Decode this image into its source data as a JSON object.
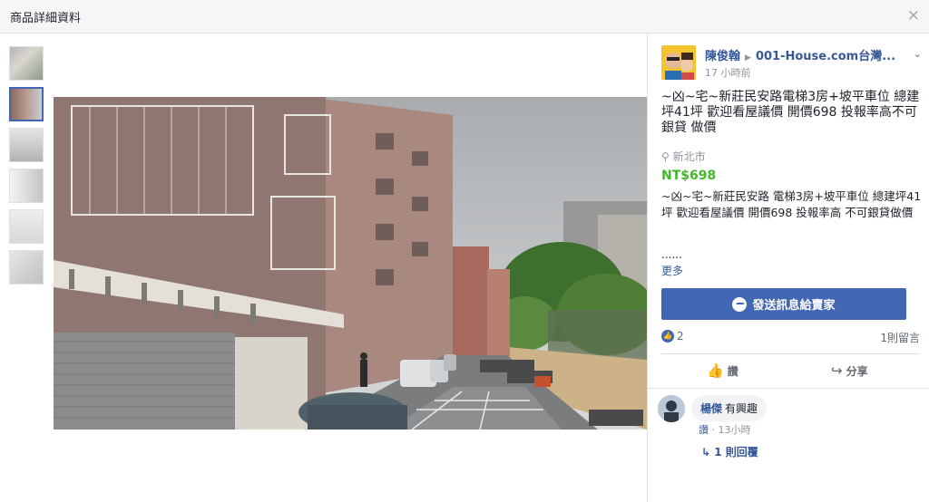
{
  "window": {
    "title": "商品詳細資料",
    "close_glyph": "×"
  },
  "gallery": {
    "thumb_count": 6,
    "active_index": 1
  },
  "seller": {
    "name": "陳俊翰",
    "arrow": "▶",
    "group": "001-House.com台灣...",
    "time": "17 小時前",
    "menu_glyph": "⌄"
  },
  "listing": {
    "title": "~凶~宅~新莊民安路電梯3房+坡平車位 總建坪41坪 歡迎看屋議價 開價698 投報率高不可銀貸 做價",
    "location_icon": "⚲",
    "location": "新北市",
    "price": "NT$698",
    "description": "~凶~宅~新莊民安路 電梯3房+坡平車位 總建坪41坪 歡迎看屋議價 開價698 投報率高 不可銀貸做價",
    "ellipsis": "......",
    "more": "更多"
  },
  "message_button": {
    "label": "發送訊息給賣家",
    "icon": "messenger-icon"
  },
  "stats": {
    "like_count": "2",
    "comments": "1則留言"
  },
  "actions": {
    "like": "讚",
    "share": "分享",
    "like_icon": "👍",
    "share_icon": "↪"
  },
  "comment": {
    "author": "楊傑",
    "text": "有興趣",
    "like_link": "讚",
    "dot": " · ",
    "time": "13小時",
    "reply_arrow": "↳",
    "replies": "1 則回覆"
  },
  "colors": {
    "accent": "#4267b2",
    "link": "#365899",
    "price": "#42b72a",
    "muted": "#90949c"
  }
}
